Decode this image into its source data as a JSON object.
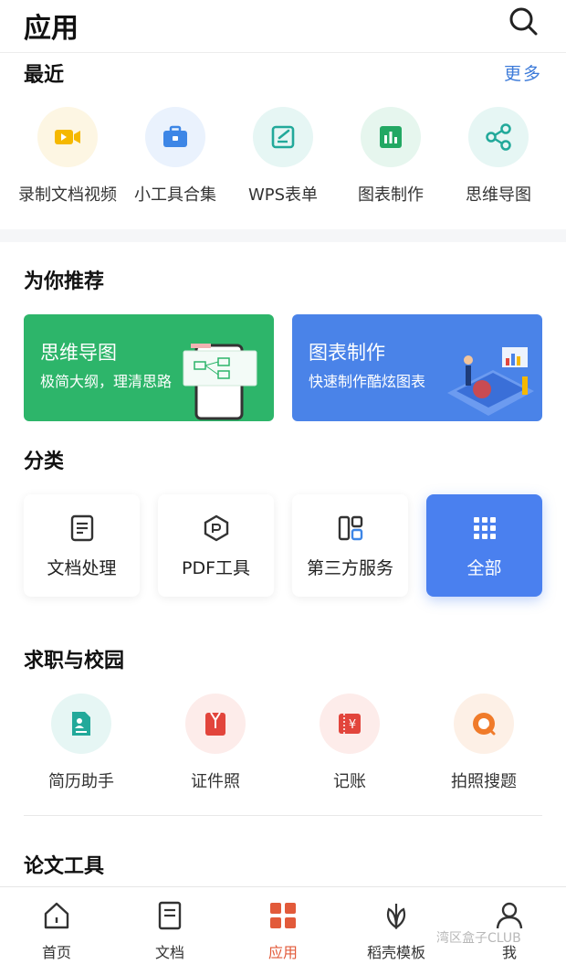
{
  "header": {
    "title": "应用",
    "search_icon": "search-icon"
  },
  "recent": {
    "title": "最近",
    "more_label": "更多",
    "items": [
      {
        "label": "录制文档视频",
        "icon": "video-camera-icon",
        "bg": "#fdf6e3",
        "color": "#f5b800"
      },
      {
        "label": "小工具合集",
        "icon": "toolbox-icon",
        "bg": "#eaf2fd",
        "color": "#3d86e6"
      },
      {
        "label": "WPS表单",
        "icon": "form-edit-icon",
        "bg": "#e6f6f4",
        "color": "#22a99a"
      },
      {
        "label": "图表制作",
        "icon": "bar-chart-icon",
        "bg": "#e6f6ee",
        "color": "#23a863"
      },
      {
        "label": "思维导图",
        "icon": "mind-map-share-icon",
        "bg": "#e6f6f4",
        "color": "#22a99a"
      }
    ]
  },
  "recommend": {
    "title": "为你推荐",
    "banners": [
      {
        "title": "思维导图",
        "subtitle": "极简大纲，理清思路",
        "color": "#2db56a"
      },
      {
        "title": "图表制作",
        "subtitle": "快速制作酷炫图表",
        "color": "#4a83e8"
      }
    ]
  },
  "categories": {
    "title": "分类",
    "items": [
      {
        "label": "文档处理",
        "icon": "document-icon",
        "active": false
      },
      {
        "label": "PDF工具",
        "icon": "pdf-hexagon-icon",
        "active": false
      },
      {
        "label": "第三方服务",
        "icon": "layout-grid-icon",
        "active": false
      },
      {
        "label": "全部",
        "icon": "dots-grid-icon",
        "active": true
      }
    ]
  },
  "career": {
    "title": "求职与校园",
    "items": [
      {
        "label": "简历助手",
        "icon": "resume-icon",
        "bg": "#e6f6f4",
        "color": "#22a99a"
      },
      {
        "label": "证件照",
        "icon": "id-photo-icon",
        "bg": "#fdecea",
        "color": "#e2453c"
      },
      {
        "label": "记账",
        "icon": "ledger-yen-icon",
        "bg": "#fdecea",
        "color": "#e2453c"
      },
      {
        "label": "拍照搜题",
        "icon": "camera-search-icon",
        "bg": "#fdf0e6",
        "color": "#f07b2a"
      }
    ]
  },
  "thesis": {
    "title": "论文工具"
  },
  "tabbar": {
    "items": [
      {
        "label": "首页",
        "icon": "home-icon",
        "active": false
      },
      {
        "label": "文档",
        "icon": "document-tab-icon",
        "active": false
      },
      {
        "label": "应用",
        "icon": "apps-grid-icon",
        "active": true
      },
      {
        "label": "稻壳模板",
        "icon": "leaf-icon",
        "active": false
      },
      {
        "label": "我",
        "icon": "user-icon",
        "active": false
      }
    ],
    "active_color": "#e25a3a"
  },
  "watermark": "湾区盒子CLUB"
}
